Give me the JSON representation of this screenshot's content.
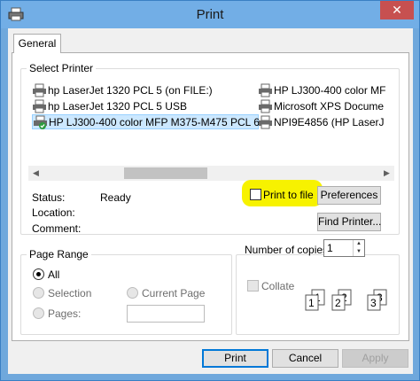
{
  "window": {
    "title": "Print"
  },
  "tabs": [
    {
      "label": "General"
    }
  ],
  "select_printer": {
    "legend": "Select Printer",
    "printers": [
      {
        "name": "hp LaserJet 1320 PCL 5 (on FILE:)",
        "selected": false
      },
      {
        "name": "HP LJ300-400 color MF",
        "selected": false
      },
      {
        "name": "hp LaserJet 1320 PCL 5 USB",
        "selected": false
      },
      {
        "name": "Microsoft XPS Docume",
        "selected": false
      },
      {
        "name": "HP LJ300-400 color MFP M375-M475 PCL 6",
        "selected": true
      },
      {
        "name": "NPI9E4856 (HP LaserJ",
        "selected": false
      }
    ]
  },
  "status": {
    "status_label": "Status:",
    "status_value": "Ready",
    "location_label": "Location:",
    "comment_label": "Comment:"
  },
  "print_to_file": {
    "label": "Print to file",
    "checked": false
  },
  "buttons": {
    "preferences": "Preferences",
    "find_printer": "Find Printer...",
    "print": "Print",
    "cancel": "Cancel",
    "apply": "Apply"
  },
  "page_range": {
    "legend": "Page Range",
    "all": "All",
    "selection": "Selection",
    "current_page": "Current Page",
    "pages": "Pages:",
    "selected_option": "All"
  },
  "copies": {
    "label": "Number of copies:",
    "value": "1",
    "collate_label": "Collate",
    "collate_checked": false,
    "collate_pages": [
      "1",
      "1",
      "2",
      "2",
      "3",
      "3"
    ]
  },
  "colors": {
    "highlight": "#f7f200",
    "selection": "#cce8ff",
    "close": "#c75050"
  }
}
